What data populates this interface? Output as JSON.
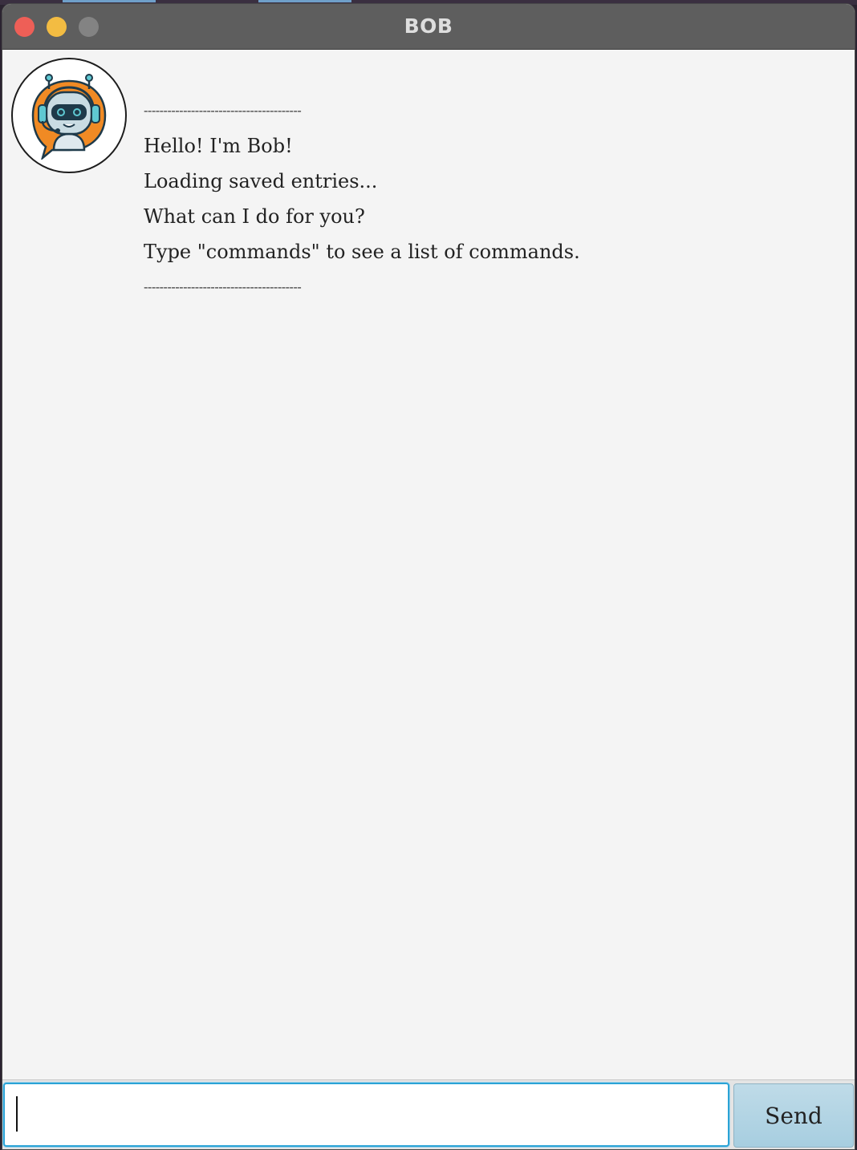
{
  "window": {
    "title": "BOB"
  },
  "chat": {
    "bot_name": "Bob",
    "messages": [
      {
        "sender": "bot",
        "lines": [
          "----------------------------------------",
          "Hello! I'm Bob!",
          "Loading saved entries...",
          "What can I do for you?",
          "Type \"commands\" to see a list of commands.",
          "----------------------------------------"
        ]
      }
    ]
  },
  "input": {
    "value": "",
    "placeholder": ""
  },
  "send_button": {
    "label": "Send"
  },
  "colors": {
    "titlebar": "#5e5e5e",
    "chat_background": "#f4f4f4",
    "input_focus_border": "#2ba3d6",
    "send_button": "#afd2e3",
    "avatar_orange": "#f08a24",
    "avatar_teal": "#5fc8d2"
  }
}
